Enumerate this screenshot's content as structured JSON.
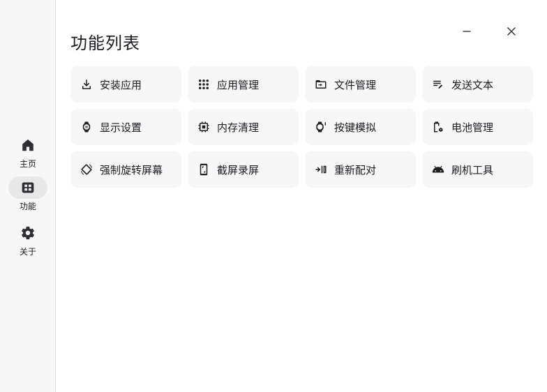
{
  "page_title": "功能列表",
  "window_controls": {
    "minimize_icon": "minimize-icon",
    "close_icon": "close-icon"
  },
  "sidebar": {
    "items": [
      {
        "label": "主页",
        "icon": "home-icon",
        "active": false
      },
      {
        "label": "功能",
        "icon": "grid-icon",
        "active": true
      },
      {
        "label": "关于",
        "icon": "gear-icon",
        "active": false
      }
    ]
  },
  "features": [
    {
      "label": "安装应用",
      "icon": "download-icon"
    },
    {
      "label": "应用管理",
      "icon": "apps-icon"
    },
    {
      "label": "文件管理",
      "icon": "folder-move-icon"
    },
    {
      "label": "发送文本",
      "icon": "text-edit-icon"
    },
    {
      "label": "显示设置",
      "icon": "watch-icon"
    },
    {
      "label": "内存清理",
      "icon": "chip-icon"
    },
    {
      "label": "按键模拟",
      "icon": "watch-button-icon"
    },
    {
      "label": "电池管理",
      "icon": "battery-settings-icon"
    },
    {
      "label": "强制旋转屏幕",
      "icon": "screen-rotate-icon"
    },
    {
      "label": "截屏录屏",
      "icon": "screenshot-icon"
    },
    {
      "label": "重新配对",
      "icon": "pair-icon"
    },
    {
      "label": "刷机工具",
      "icon": "android-icon"
    }
  ]
}
